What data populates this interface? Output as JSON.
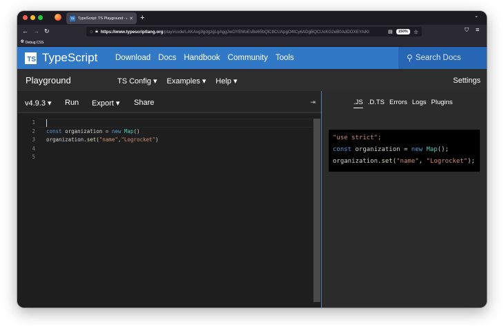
{
  "browser": {
    "tab_title": "TypeScript: TS Playground - An",
    "tab_favicon_text": "TS",
    "new_tab_glyph": "+",
    "url_host": "https://www.typescriptlang.org",
    "url_path": "/play#code/LAKAxg9gdgzgLgAggJwOYEMoEsBe65bQlC8CUApgO4ICy6ADgBQCUoKG2eB0AdDOXEYAiKI",
    "zoom": "150%",
    "bookmark": "Debug CSS",
    "icons": {
      "back": "arrow-left-icon",
      "forward": "arrow-right-icon",
      "reload": "reload-icon",
      "tracking": "shield-icon",
      "lock": "lock-icon",
      "reader": "reader-view-icon",
      "bookmark_star": "star-icon",
      "menu": "hamburger-icon"
    }
  },
  "site_header": {
    "logo_text": "TS",
    "brand": "TypeScript",
    "nav": [
      "Download",
      "Docs",
      "Handbook",
      "Community",
      "Tools"
    ],
    "search_placeholder": "Search Docs",
    "colors": {
      "header": "#3178c6",
      "search_bg": "#2765b5"
    }
  },
  "playground_bar": {
    "title": "Playground",
    "menus": [
      "TS Config",
      "Examples",
      "Help"
    ],
    "settings": "Settings"
  },
  "editor_toolbar": {
    "version": "v4.9.3",
    "run": "Run",
    "export": "Export",
    "share": "Share",
    "collapse_glyph": "⇥"
  },
  "editor": {
    "line_numbers": [
      "1",
      "2",
      "3",
      "4",
      "5"
    ],
    "tokens": {
      "kw_const": "const",
      "org_assign": " organization = ",
      "kw_new": "new",
      "map_fn": "Map",
      "parens": "()",
      "org_ref": "organization.",
      "set_fn": "set",
      "open_paren": "(",
      "str_name": "\"name\"",
      "comma": ",",
      "str_logrocket": "\"Logrocket\"",
      "close_paren": ")"
    }
  },
  "output": {
    "tabs": [
      ".JS",
      ".D.TS",
      "Errors",
      "Logs",
      "Plugins"
    ],
    "active_tab": ".JS",
    "lines": {
      "use_strict": "\"use strict\";",
      "const_kw": "const",
      "org_assign": " organization = ",
      "new_kw": "new",
      "map_fn": "Map",
      "semi_call": "();",
      "org_ref": "organization.",
      "set_fn": "set",
      "open_paren": "(",
      "str_name": "\"name\"",
      "comma_space": ", ",
      "str_logrocket": "\"Logrocket\"",
      "end": ");"
    }
  }
}
